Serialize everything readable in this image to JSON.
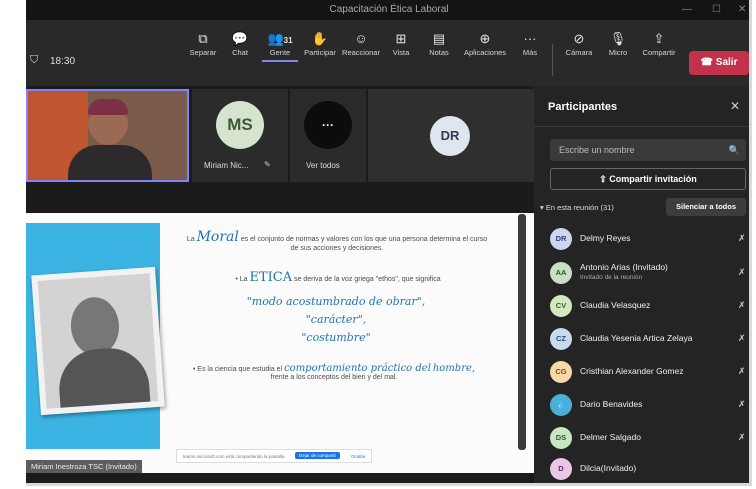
{
  "window": {
    "title": "Capacitación Ética Laboral"
  },
  "toolbar": {
    "time": "18:30",
    "people_count": "31",
    "buttons": [
      {
        "label": "Separar",
        "icon": "popout-icon"
      },
      {
        "label": "Chat",
        "icon": "chat-icon"
      },
      {
        "label": "Gente",
        "icon": "people-icon"
      },
      {
        "label": "Participar",
        "icon": "raise-hand-icon"
      },
      {
        "label": "Reaccionar",
        "icon": "smiley-icon"
      },
      {
        "label": "Vista",
        "icon": "grid-icon"
      },
      {
        "label": "Notas",
        "icon": "notes-icon"
      },
      {
        "label": "Aplicaciones",
        "icon": "add-app-icon"
      },
      {
        "label": "Más",
        "icon": "more-icon"
      },
      {
        "label": "Cámara",
        "icon": "camera-off-icon"
      },
      {
        "label": "Micro",
        "icon": "mic-off-icon"
      },
      {
        "label": "Compartir",
        "icon": "share-icon"
      }
    ],
    "leave_label": "Salir"
  },
  "tiles": {
    "ms_initials": "MS",
    "ms_name": "Miriam Nic...",
    "see_all_label": "Ver todos",
    "see_all_glyph": "···",
    "dr_initials": "DR"
  },
  "slide": {
    "line1_prefix": "La",
    "line1_word": "Moral",
    "line1_rest": "es el conjunto de normas y valores con los que una persona determina el curso de sus acciones y decisiones.",
    "line2_prefix": "• La",
    "line2_word": "ETICA",
    "line2_rest": "se deriva de la voz griega \"ethos\", que significa",
    "hand1": "\"modo acostumbrado de obrar\",",
    "hand2": "\"carácter\",",
    "hand3": "\"costumbre\"",
    "line3_prefix": "• Es la ciencia que estudia el",
    "line3_word1": "comportamiento práctico del",
    "line3_word2": "hombre,",
    "line3_rest": "frente a los conceptos del bien y del mal.",
    "share_notice": "teams.microsoft.com está compartiendo la pantalla",
    "stop_share": "Dejar de compartir",
    "hide": "Ocultar"
  },
  "presenter_label": "Miriam Inestroza TSC (Invitado)",
  "panel": {
    "title": "Participantes",
    "search_placeholder": "Escribe un nombre",
    "share_invite": "Compartir invitación",
    "in_meeting": "En esta reunión (31)",
    "mute_all": "Silenciar a todos",
    "participants": [
      {
        "initials": "DR",
        "name": "Delmy Reyes",
        "sub": "",
        "color": "#cfd4f2",
        "fg": "#3b3f6b"
      },
      {
        "initials": "AA",
        "name": "Antonio Arias (Invitado)",
        "sub": "Invitado de la reunión",
        "color": "#c8e0c4",
        "fg": "#2e5a2a"
      },
      {
        "initials": "CV",
        "name": "Claudia Velasquez",
        "sub": "",
        "color": "#d4e8c0",
        "fg": "#3d5a23"
      },
      {
        "initials": "CZ",
        "name": "Claudia Yesenia Artica Zelaya",
        "sub": "",
        "color": "#cbd9ec",
        "fg": "#2d4a70"
      },
      {
        "initials": "CG",
        "name": "Cristhian Alexander Gomez",
        "sub": "",
        "color": "#f6d9a6",
        "fg": "#7a4f0f"
      },
      {
        "initials": "",
        "name": "Dario Benavides",
        "sub": "",
        "color": "#4ab0d8",
        "fg": "#ffffff"
      },
      {
        "initials": "DS",
        "name": "Delmer Salgado",
        "sub": "",
        "color": "#c9e6c3",
        "fg": "#2d5e29"
      },
      {
        "initials": "D",
        "name": "Dilcia(Invitado)",
        "sub": "",
        "color": "#e9c7e6",
        "fg": "#6b2b66"
      }
    ]
  },
  "colors": {
    "accent": "#7f85f5",
    "leave": "#c4314b",
    "slide_blue": "#3cb4e3",
    "handwriting": "#1d73b7"
  }
}
